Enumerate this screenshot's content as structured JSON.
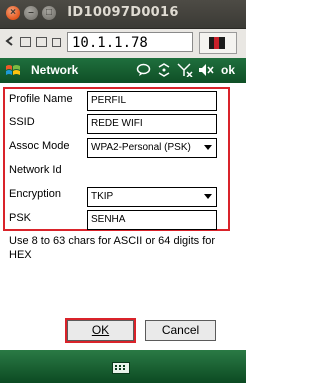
{
  "window": {
    "title": "ID10097D0016"
  },
  "toolbar": {
    "address": "10.1.1.78"
  },
  "header": {
    "title": "Network",
    "ok_label": "ok"
  },
  "form": {
    "profile_name": {
      "label": "Profile Name",
      "value": "PERFIL"
    },
    "ssid": {
      "label": "SSID",
      "value": "REDE WIFI"
    },
    "assoc_mode": {
      "label": "Assoc Mode",
      "value": "WPA2-Personal (PSK)"
    },
    "network_id": {
      "label": "Network Id"
    },
    "encryption": {
      "label": "Encryption",
      "value": "TKIP"
    },
    "psk": {
      "label": "PSK",
      "value": "SENHA"
    }
  },
  "hint": "Use 8 to 63 chars for ASCII or 64 digits for HEX",
  "buttons": {
    "ok": "OK",
    "cancel": "Cancel"
  },
  "colors": {
    "header_green": "#1f6f3d",
    "highlight_red": "#d9232a"
  }
}
